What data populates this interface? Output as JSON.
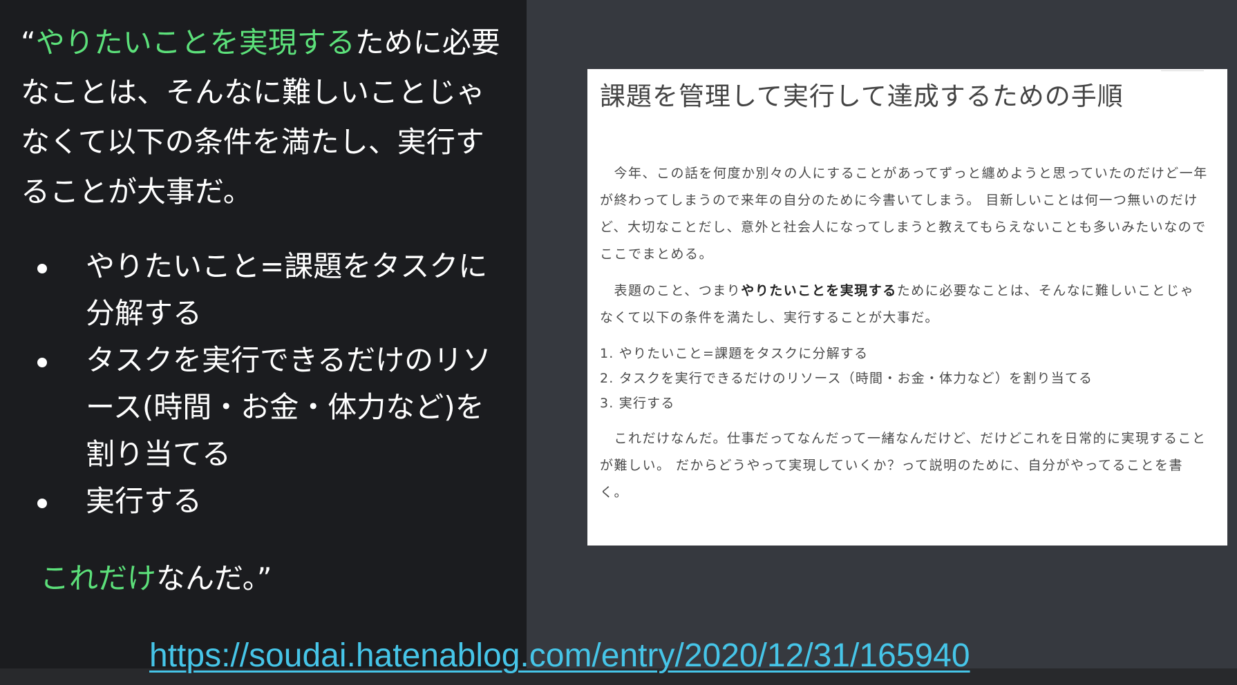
{
  "quote": {
    "open_mark": "“",
    "highlight_1": "やりたいことを実現する",
    "text_1": "ために必要なことは、そんなに難しいことじゃなくて以下の条件を満たし、実行することが大事だ。"
  },
  "bullets": [
    "やりたいこと=課題をタスクに分解する",
    "タスクを実行できるだけのリソース(時間・お金・体力など)を割り当てる",
    "実行する"
  ],
  "closing": {
    "highlight": "これだけ",
    "text": "なんだ。”"
  },
  "url": "https://soudai.hatenablog.com/entry/2020/12/31/165940",
  "article": {
    "title": "課題を管理して実行して達成するための手順",
    "para_1": "今年、この話を何度か別々の人にすることがあってずっと纏めようと思っていたのだけど一年が終わってしまうので来年の自分のために今書いてしまう。 目新しいことは何一つ無いのだけど、大切なことだし、意外と社会人になってしまうと教えてもらえないことも多いみたいなのでここでまとめる。",
    "para_2_pre": "表題のこと、つまり",
    "para_2_bold": "やりたいことを実現する",
    "para_2_post": "ために必要なことは、そんなに難しいことじゃなくて以下の条件を満たし、実行することが大事だ。",
    "list": [
      "1. やりたいこと=課題をタスクに分解する",
      "2. タスクを実行できるだけのリソース（時間・お金・体力など）を割り当てる",
      "3. 実行する"
    ],
    "para_3": "これだけなんだ。仕事だってなんだって一緒なんだけど、だけどこれを日常的に実現することが難しい。 だからどうやって実現していくか？って説明のために、自分がやってることを書く。"
  },
  "colors": {
    "accent_green": "#5ce07a",
    "link_cyan": "#46c5e8",
    "left_bg": "#1b1c1f",
    "right_bg": "#36393f"
  }
}
